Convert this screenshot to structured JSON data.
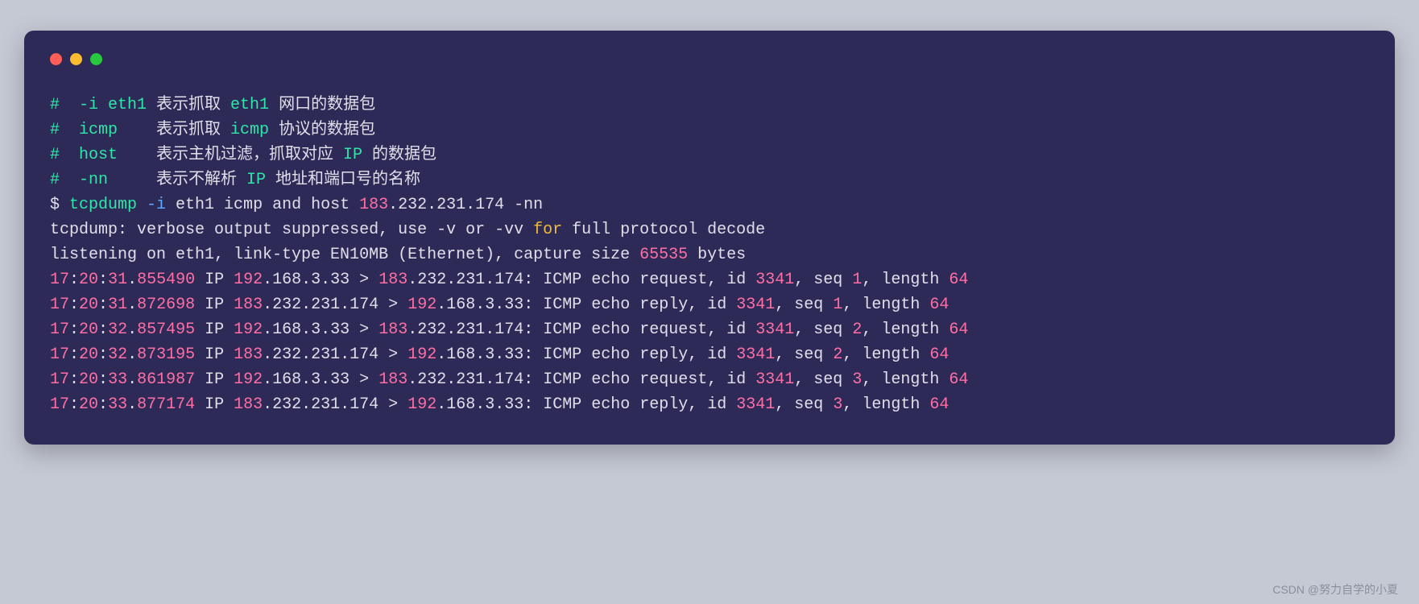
{
  "comments": [
    [
      {
        "t": "#  -i eth1",
        "c": "c-green"
      },
      {
        "t": " 表示抓取 ",
        "c": "c-white"
      },
      {
        "t": "eth1",
        "c": "c-green"
      },
      {
        "t": " 网口的数据包",
        "c": "c-white"
      }
    ],
    [
      {
        "t": "#  icmp",
        "c": "c-green"
      },
      {
        "t": "    表示抓取 ",
        "c": "c-white"
      },
      {
        "t": "icmp",
        "c": "c-green"
      },
      {
        "t": " 协议的数据包",
        "c": "c-white"
      }
    ],
    [
      {
        "t": "#  host",
        "c": "c-green"
      },
      {
        "t": "    表示主机过滤，抓取对应 ",
        "c": "c-white"
      },
      {
        "t": "IP",
        "c": "c-green"
      },
      {
        "t": " 的数据包",
        "c": "c-white"
      }
    ],
    [
      {
        "t": "#  -nn",
        "c": "c-green"
      },
      {
        "t": "     表示不解析 ",
        "c": "c-white"
      },
      {
        "t": "IP",
        "c": "c-green"
      },
      {
        "t": " 地址和端口号的名称",
        "c": "c-white"
      }
    ]
  ],
  "command_line": [
    {
      "t": "$ ",
      "c": "c-white"
    },
    {
      "t": "tcpdump",
      "c": "c-green"
    },
    {
      "t": " -i ",
      "c": "c-blue"
    },
    {
      "t": "eth1 icmp and host ",
      "c": "c-white"
    },
    {
      "t": "183",
      "c": "c-pink"
    },
    {
      "t": ".232.231.174 -nn",
      "c": "c-white"
    }
  ],
  "output_header": [
    [
      {
        "t": "tcpdump: verbose output suppressed, use -v or -vv ",
        "c": "c-white"
      },
      {
        "t": "for",
        "c": "c-yellow"
      },
      {
        "t": " full protocol decode",
        "c": "c-white"
      }
    ],
    [
      {
        "t": "listening on eth1, link-type EN10MB (Ethernet), capture size ",
        "c": "c-white"
      },
      {
        "t": "65535",
        "c": "c-pink"
      },
      {
        "t": " bytes",
        "c": "c-white"
      }
    ]
  ],
  "packets": [
    {
      "time": "17:20:31.855490",
      "src": "192.168.3.33",
      "a": "192",
      "arest": ".168.3.33",
      "gt": " > ",
      "dst": "183.232.231.174",
      "b": "183",
      "brest": ".232.231.174",
      "type": "request",
      "id": "3341",
      "seq": "1",
      "len": "64"
    },
    {
      "time": "17:20:31.872698",
      "src": "183.232.231.174",
      "a": "183",
      "arest": ".232.231.174",
      "gt": " > ",
      "dst": "192.168.3.33",
      "b": "192",
      "brest": ".168.3.33",
      "type": "reply",
      "id": "3341",
      "seq": "1",
      "len": "64"
    },
    {
      "time": "17:20:32.857495",
      "src": "192.168.3.33",
      "a": "192",
      "arest": ".168.3.33",
      "gt": " > ",
      "dst": "183.232.231.174",
      "b": "183",
      "brest": ".232.231.174",
      "type": "request",
      "id": "3341",
      "seq": "2",
      "len": "64"
    },
    {
      "time": "17:20:32.873195",
      "src": "183.232.231.174",
      "a": "183",
      "arest": ".232.231.174",
      "gt": " > ",
      "dst": "192.168.3.33",
      "b": "192",
      "brest": ".168.3.33",
      "type": "reply",
      "id": "3341",
      "seq": "2",
      "len": "64"
    },
    {
      "time": "17:20:33.861987",
      "src": "192.168.3.33",
      "a": "192",
      "arest": ".168.3.33",
      "gt": " > ",
      "dst": "183.232.231.174",
      "b": "183",
      "brest": ".232.231.174",
      "type": "request",
      "id": "3341",
      "seq": "3",
      "len": "64"
    },
    {
      "time": "17:20:33.877174",
      "src": "183.232.231.174",
      "a": "183",
      "arest": ".232.231.174",
      "gt": " > ",
      "dst": "192.168.3.33",
      "b": "192",
      "brest": ".168.3.33",
      "type": "reply",
      "id": "3341",
      "seq": "3",
      "len": "64"
    }
  ],
  "watermark": "CSDN @努力自学的小夏"
}
